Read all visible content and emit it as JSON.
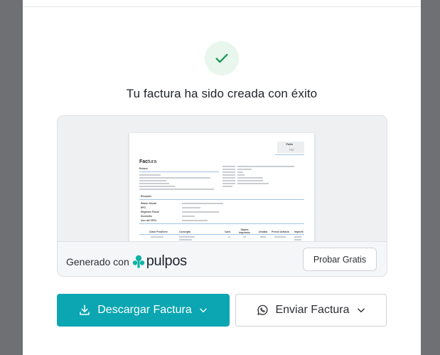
{
  "modal": {
    "title": "Tu factura ha sido creada con éxito",
    "success_icon": "check-icon",
    "colors": {
      "accent": "#0ba6b1",
      "success": "#1a9b52",
      "success_bg": "#e8f6ee",
      "overlay": "#6f7073"
    }
  },
  "invoice_preview": {
    "folio_label": "Folio",
    "folio_value": "F87",
    "title_bold": "Fac",
    "title_rest": "tura",
    "emisor_label": "Emisor",
    "receptor_label": "Receptor",
    "receptor_fields": [
      "Razón Social",
      "RFC",
      "Régimen Fiscal",
      "Domicilio",
      "Uso del CFDI"
    ],
    "columns": [
      "Clave ProdServ",
      "Concepto",
      "Cant.",
      "Objeto impuesto",
      "Unidad",
      "Precio Unitario",
      "Importe"
    ]
  },
  "footer": {
    "generated_label": "Generado con",
    "brand": "pulpos",
    "brand_icon": "pulpos-logo-icon",
    "try_button": "Probar Gratis"
  },
  "actions": {
    "download_label": "Descargar Factura",
    "download_icon": "download-icon",
    "send_label": "Enviar Factura",
    "send_icon": "whatsapp-icon",
    "chevron_icon": "chevron-down-icon"
  }
}
